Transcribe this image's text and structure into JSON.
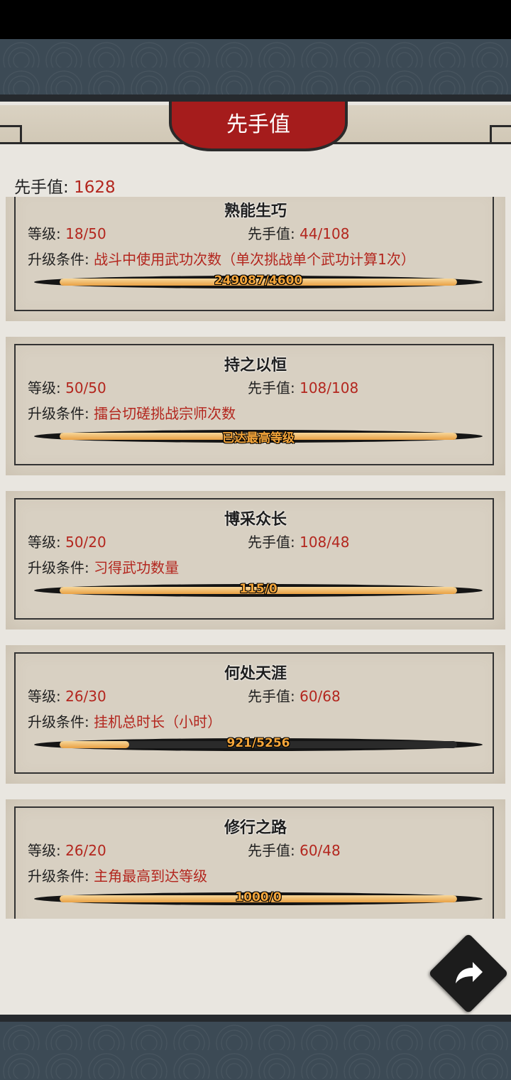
{
  "dialog": {
    "title": "先手值"
  },
  "total": {
    "label": "先手值:",
    "value": "1628"
  },
  "labels": {
    "level": "等级:",
    "initiative": "先手值:",
    "condition": "升级条件:"
  },
  "items": [
    {
      "name": "熟能生巧",
      "level": "18/50",
      "initiative": "44/108",
      "condition": "战斗中使用武功次数（单次挑战单个武功计算1次）",
      "progress_text": "249087/4600",
      "progress": 1.0
    },
    {
      "name": "持之以恒",
      "level": "50/50",
      "initiative": "108/108",
      "condition": "擂台切磋挑战宗师次数",
      "progress_text": "已达最高等级",
      "progress": 1.0
    },
    {
      "name": "博采众长",
      "level": "50/20",
      "initiative": "108/48",
      "condition": "习得武功数量",
      "progress_text": "115/0",
      "progress": 1.0
    },
    {
      "name": "何处天涯",
      "level": "26/30",
      "initiative": "60/68",
      "condition": "挂机总时长（小时）",
      "progress_text": "921/5256",
      "progress": 0.175
    },
    {
      "name": "修行之路",
      "level": "26/20",
      "initiative": "60/48",
      "condition": "主角最高到达等级",
      "progress_text": "1000/0",
      "progress": 1.0
    }
  ],
  "icons": {
    "share": "share-arrow-icon"
  },
  "colors": {
    "accent_red": "#a51c1c",
    "value_red": "#b3261e",
    "bar_gold": "#e9a144"
  }
}
